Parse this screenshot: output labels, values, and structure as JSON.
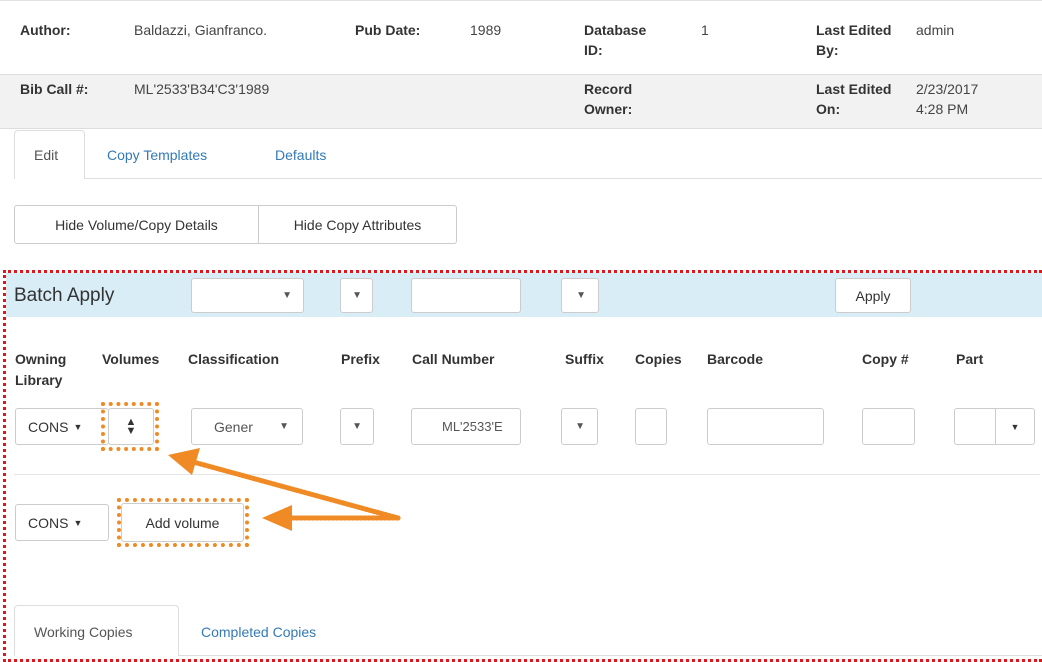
{
  "record": {
    "author_label": "Author:",
    "author_value": "Baldazzi, Gianfranco.",
    "pubdate_label": "Pub Date:",
    "pubdate_value": "1989",
    "dbid_label_1": "Database",
    "dbid_label_2": "ID:",
    "dbid_value": "1",
    "lastedited_by_label_1": "Last Edited",
    "lastedited_by_label_2": "By:",
    "lastedited_by_value": "admin",
    "bibcall_label": "Bib Call #:",
    "bibcall_value": "ML'2533'B34'C3'1989",
    "owner_label_1": "Record",
    "owner_label_2": "Owner:",
    "lastedited_on_label_1": "Last Edited",
    "lastedited_on_label_2": "On:",
    "lastedited_on_value_1": "2/23/2017",
    "lastedited_on_value_2": "4:28 PM"
  },
  "tabs": {
    "edit": "Edit",
    "copy_templates": "Copy Templates",
    "defaults": "Defaults"
  },
  "toggles": {
    "hide_volume_copy": "Hide Volume/Copy Details",
    "hide_copy_attr": "Hide Copy Attributes"
  },
  "batch": {
    "title": "Batch Apply",
    "apply": "Apply"
  },
  "columns": {
    "owning_1": "Owning",
    "owning_2": "Library",
    "volumes": "Volumes",
    "classification": "Classification",
    "prefix": "Prefix",
    "call_number": "Call Number",
    "suffix": "Suffix",
    "copies": "Copies",
    "barcode": "Barcode",
    "copy_num": "Copy #",
    "part": "Part"
  },
  "row": {
    "library": "CONS",
    "classification": "Gener",
    "call_number": "ML'2533'E"
  },
  "add_volume": {
    "library": "CONS",
    "label": "Add volume"
  },
  "bottom_tabs": {
    "working": "Working Copies",
    "completed": "Completed Copies"
  },
  "colors": {
    "annotation_orange": "#f08a24",
    "annotation_red": "#e0161b",
    "link_blue": "#337ab7",
    "batch_bg": "#d9edf7"
  }
}
